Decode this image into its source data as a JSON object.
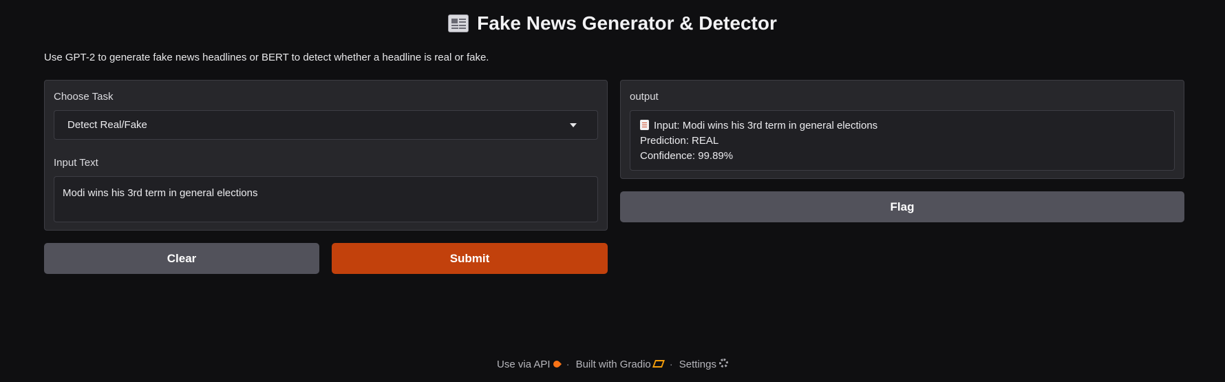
{
  "header": {
    "title": "Fake News Generator & Detector",
    "description": "Use GPT-2 to generate fake news headlines or BERT to detect whether a headline is real or fake."
  },
  "input_panel": {
    "task_label": "Choose Task",
    "task_selected": "Detect Real/Fake",
    "text_label": "Input Text",
    "text_value": "Modi wins his 3rd term in general elections"
  },
  "output_panel": {
    "label": "output",
    "line_input": "Input: Modi wins his 3rd term in general elections",
    "line_prediction": "Prediction: REAL",
    "line_confidence": "Confidence: 99.89%"
  },
  "buttons": {
    "clear": "Clear",
    "submit": "Submit",
    "flag": "Flag"
  },
  "footer": {
    "api": "Use via API",
    "built": "Built with Gradio",
    "settings": "Settings",
    "separator": "·"
  },
  "icons": [
    "newspaper-icon",
    "document-icon",
    "chevron-down-icon",
    "rocket-icon",
    "gradio-logo-icon",
    "gear-icon"
  ],
  "colors": {
    "background": "#0f0f11",
    "panel": "#27272b",
    "primary_button": "#c2410c",
    "secondary_button": "#52525b"
  }
}
